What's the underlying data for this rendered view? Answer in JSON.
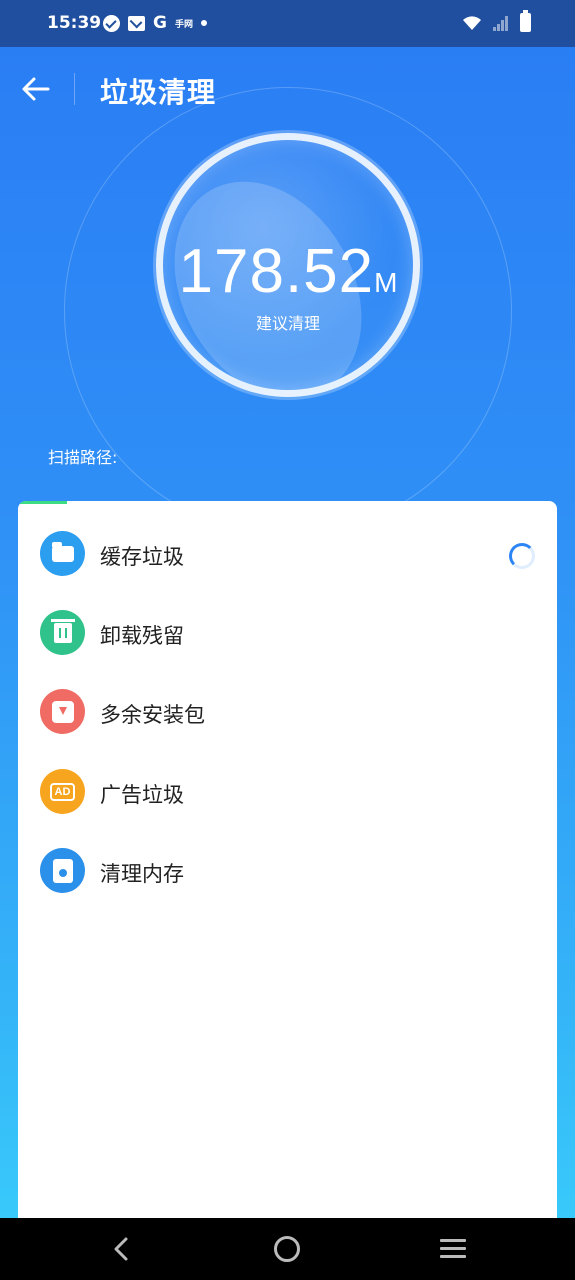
{
  "status_bar": {
    "time": "15:39",
    "left_icons": [
      "check-circle-icon",
      "mail-icon",
      "google-icon",
      "app-icon",
      "dot-icon"
    ],
    "google_label": "G",
    "app_label": "手网",
    "right_icons": [
      "wifi-icon",
      "signal-icon",
      "battery-icon"
    ]
  },
  "header": {
    "title": "垃圾清理",
    "back_icon": "arrow-left-icon"
  },
  "gauge": {
    "value": "178.52",
    "unit": "M",
    "caption": "建议清理"
  },
  "scan": {
    "label": "扫描路径:",
    "progress": 0.09
  },
  "list": {
    "items": [
      {
        "label": "缓存垃圾",
        "icon": "folder-icon",
        "color": "#2b9ef0",
        "status": "loading"
      },
      {
        "label": "卸载残留",
        "icon": "trash-icon",
        "color": "#2fc28a"
      },
      {
        "label": "多余安装包",
        "icon": "package-icon",
        "color": "#ef6b63"
      },
      {
        "label": "广告垃圾",
        "icon": "ad-icon",
        "color": "#f7a51e",
        "icon_text": "AD"
      },
      {
        "label": "清理内存",
        "icon": "memory-card-icon",
        "color": "#2b90ea"
      }
    ]
  },
  "colors": {
    "accent": "#2b85f5",
    "status_bar": "#1f4f9e",
    "progress": "#3ddc84"
  },
  "nav_bar": {
    "icons": [
      "nav-back-icon",
      "nav-home-icon",
      "nav-menu-icon"
    ]
  }
}
